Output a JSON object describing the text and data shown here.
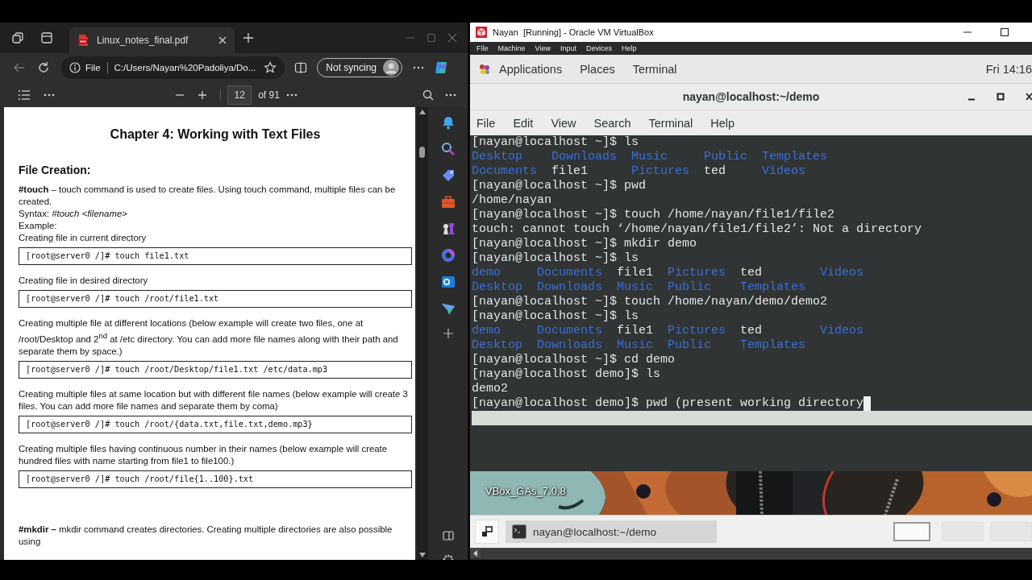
{
  "browser": {
    "tab": {
      "title": "Linux_notes_final.pdf",
      "selected": true
    },
    "address": {
      "scheme": "File",
      "url": "C:/Users/Nayan%20Padoliya/Do..."
    },
    "sync_button": "Not syncing",
    "pdf_toolbar": {
      "page": "12",
      "page_count": "of 91"
    },
    "document": [
      {
        "kind": "chapter",
        "text": "Chapter 4: Working with Text Files"
      },
      {
        "kind": "section",
        "text": "File Creation:"
      },
      {
        "kind": "para",
        "text": "**#touch** – touch command is used to create files. Using touch command, multiple files can be created."
      },
      {
        "kind": "line",
        "text": "Syntax: *#touch <filename>*"
      },
      {
        "kind": "line",
        "text": "Example:"
      },
      {
        "kind": "line",
        "text": "Creating file in current directory"
      },
      {
        "kind": "code",
        "text": "[root@server0 /]# touch file1.txt"
      },
      {
        "kind": "line",
        "text": "Creating file in desired directory"
      },
      {
        "kind": "code",
        "text": "[root@server0 /]# touch /root/file1.txt"
      },
      {
        "kind": "line",
        "text": "Creating multiple file at different locations (below example will create two files, one at /root/Desktop and 2$^{nd}$ at /etc directory. You can add more file names along with their path and separate them by space.)"
      },
      {
        "kind": "code",
        "text": "[root@server0 /]# touch /root/Desktop/file1.txt /etc/data.mp3"
      },
      {
        "kind": "line",
        "text": "Creating multiple files at same location but with different file names (below example will create 3 files. You can add more file names and separate them by coma)"
      },
      {
        "kind": "code",
        "text": "[root@server0 /]# touch /root/{data.txt,file.txt,demo.mp3}"
      },
      {
        "kind": "line",
        "text": "Creating multiple files having continuous number in their names (below example will create hundred files with name starting from file1 to file100.)"
      },
      {
        "kind": "code",
        "text": "[root@server0 /]# touch /root/file{1..100}.txt"
      },
      {
        "kind": "gap_para",
        "text": "**#mkdir –** mkdir command creates directories. Creating multiple directories are also possible using"
      }
    ]
  },
  "vm": {
    "title": "Nayan  [Running] - Oracle VM VirtualBox",
    "menu": [
      "File",
      "Machine",
      "View",
      "Input",
      "Devices",
      "Help"
    ],
    "top_bar": {
      "menus": [
        "Applications",
        "Places",
        "Terminal"
      ],
      "clock": "Fri 14:16"
    },
    "terminal": {
      "title": "nayan@localhost:~/demo",
      "menu": [
        "File",
        "Edit",
        "View",
        "Search",
        "Terminal",
        "Help"
      ],
      "lines": [
        {
          "kind": "text",
          "text": "[nayan@localhost ~]$ ls",
          "cursor": false,
          "highlighted": false
        },
        {
          "kind": "ls",
          "rows": [
            [
              {
                "name": "Desktop",
                "kind": "dir"
              },
              {
                "name": "Downloads",
                "kind": "dir"
              },
              {
                "name": "Music",
                "kind": "dir"
              },
              {
                "name": "Public",
                "kind": "dir"
              },
              {
                "name": "Templates",
                "kind": "dir"
              }
            ],
            [
              {
                "name": "Documents",
                "kind": "dir"
              },
              {
                "name": "file1",
                "kind": "file"
              },
              {
                "name": "Pictures",
                "kind": "dir"
              },
              {
                "name": "ted",
                "kind": "file"
              },
              {
                "name": "Videos",
                "kind": "dir"
              }
            ]
          ],
          "cursor": false,
          "highlighted": false
        },
        {
          "kind": "text",
          "text": "[nayan@localhost ~]$ pwd",
          "cursor": false,
          "highlighted": false
        },
        {
          "kind": "text",
          "text": "/home/nayan",
          "cursor": false,
          "highlighted": false
        },
        {
          "kind": "text",
          "text": "[nayan@localhost ~]$ touch /home/nayan/file1/file2",
          "cursor": false,
          "highlighted": false
        },
        {
          "kind": "text",
          "text": "touch: cannot touch ‘/home/nayan/file1/file2’: Not a directory",
          "cursor": false,
          "highlighted": false
        },
        {
          "kind": "text",
          "text": "[nayan@localhost ~]$ mkdir demo",
          "cursor": false,
          "highlighted": false
        },
        {
          "kind": "text",
          "text": "[nayan@localhost ~]$ ls",
          "cursor": false,
          "highlighted": false
        },
        {
          "kind": "ls",
          "rows": [
            [
              {
                "name": "demo",
                "kind": "dir"
              },
              {
                "name": "Documents",
                "kind": "dir"
              },
              {
                "name": "file1",
                "kind": "file"
              },
              {
                "name": "Pictures",
                "kind": "dir"
              },
              {
                "name": "ted",
                "kind": "file"
              },
              {
                "name": "Videos",
                "kind": "dir"
              }
            ],
            [
              {
                "name": "Desktop",
                "kind": "dir"
              },
              {
                "name": "Downloads",
                "kind": "dir"
              },
              {
                "name": "Music",
                "kind": "dir"
              },
              {
                "name": "Public",
                "kind": "dir"
              },
              {
                "name": "Templates",
                "kind": "dir"
              }
            ]
          ],
          "cursor": false,
          "highlighted": false
        },
        {
          "kind": "text",
          "text": "[nayan@localhost ~]$ touch /home/nayan/demo/demo2",
          "cursor": false,
          "highlighted": false
        },
        {
          "kind": "text",
          "text": "[nayan@localhost ~]$ ls",
          "cursor": false,
          "highlighted": false
        },
        {
          "kind": "ls",
          "rows": [
            [
              {
                "name": "demo",
                "kind": "dir"
              },
              {
                "name": "Documents",
                "kind": "dir"
              },
              {
                "name": "file1",
                "kind": "file"
              },
              {
                "name": "Pictures",
                "kind": "dir"
              },
              {
                "name": "ted",
                "kind": "file"
              },
              {
                "name": "Videos",
                "kind": "dir"
              }
            ],
            [
              {
                "name": "Desktop",
                "kind": "dir"
              },
              {
                "name": "Downloads",
                "kind": "dir"
              },
              {
                "name": "Music",
                "kind": "dir"
              },
              {
                "name": "Public",
                "kind": "dir"
              },
              {
                "name": "Templates",
                "kind": "dir"
              }
            ]
          ],
          "cursor": false,
          "highlighted": false
        },
        {
          "kind": "text",
          "text": "[nayan@localhost ~]$ cd demo",
          "cursor": false,
          "highlighted": false
        },
        {
          "kind": "text",
          "text": "[nayan@localhost demo]$ ls",
          "cursor": false,
          "highlighted": false
        },
        {
          "kind": "text",
          "text": "demo2",
          "cursor": false,
          "highlighted": false
        },
        {
          "kind": "text",
          "text": "[nayan@localhost demo]$ pwd (present working directory",
          "cursor": true,
          "highlighted": false
        },
        {
          "kind": "blank",
          "cursor": false,
          "highlighted": true
        }
      ]
    },
    "desktop_icon": {
      "label": "VBox_GAs_7.0.8"
    },
    "taskbar": {
      "task": "nayan@localhost:~/demo",
      "workspaces": [
        {
          "selected": true
        },
        {
          "selected": false
        },
        {
          "selected": false
        }
      ]
    }
  }
}
